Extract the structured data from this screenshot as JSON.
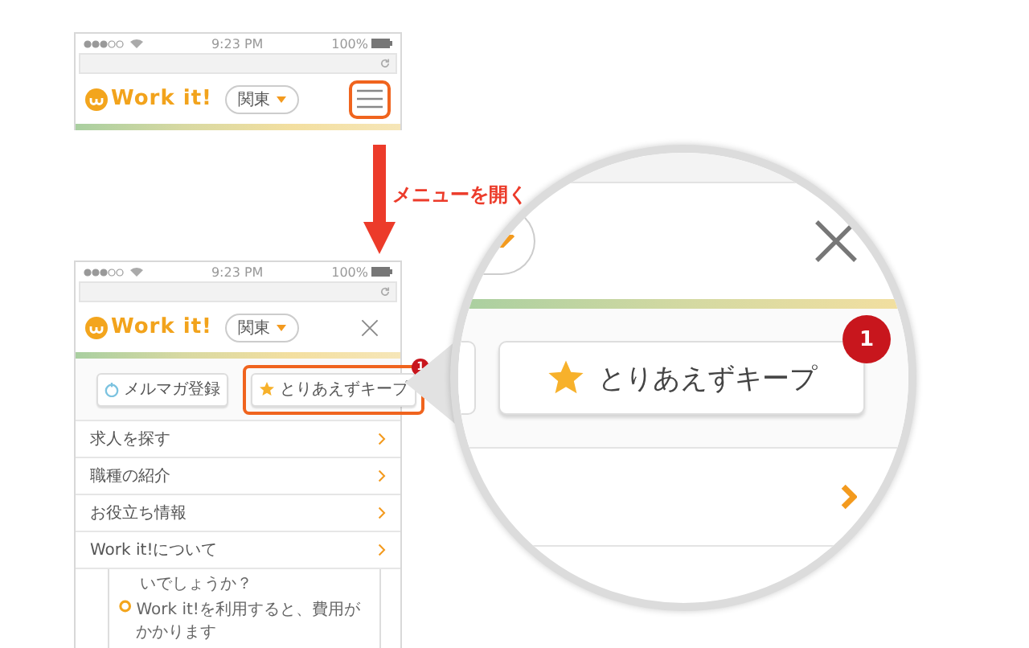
{
  "before": {
    "time": "9:23 PM",
    "battery": "100%",
    "logo": "Work it!",
    "region": "関東",
    "header_button": {
      "kind": "menu",
      "highlighted": true
    }
  },
  "step_label": "メニューを開く",
  "after": {
    "time": "9:23 PM",
    "battery": "100%",
    "logo": "Work it!",
    "region": "関東",
    "header_button": {
      "kind": "close",
      "highlighted": false
    },
    "buttons": [
      {
        "kind": "mail",
        "label": "メルマガ登録",
        "highlighted": false
      },
      {
        "kind": "keep",
        "label": "とりあえずキープ",
        "badge": "1",
        "highlighted": true
      }
    ],
    "menu": [
      "求人を探す",
      "職種の紹介",
      "お役立ち情報",
      "Work it!について"
    ],
    "faq": [
      {
        "kind": "continuation",
        "text": "いでしょうか？"
      },
      {
        "kind": "question",
        "text": "Work it!を利用すると、費用がかかります"
      }
    ]
  },
  "zoom": {
    "label": "とりあえずキープ",
    "badge": "1"
  }
}
